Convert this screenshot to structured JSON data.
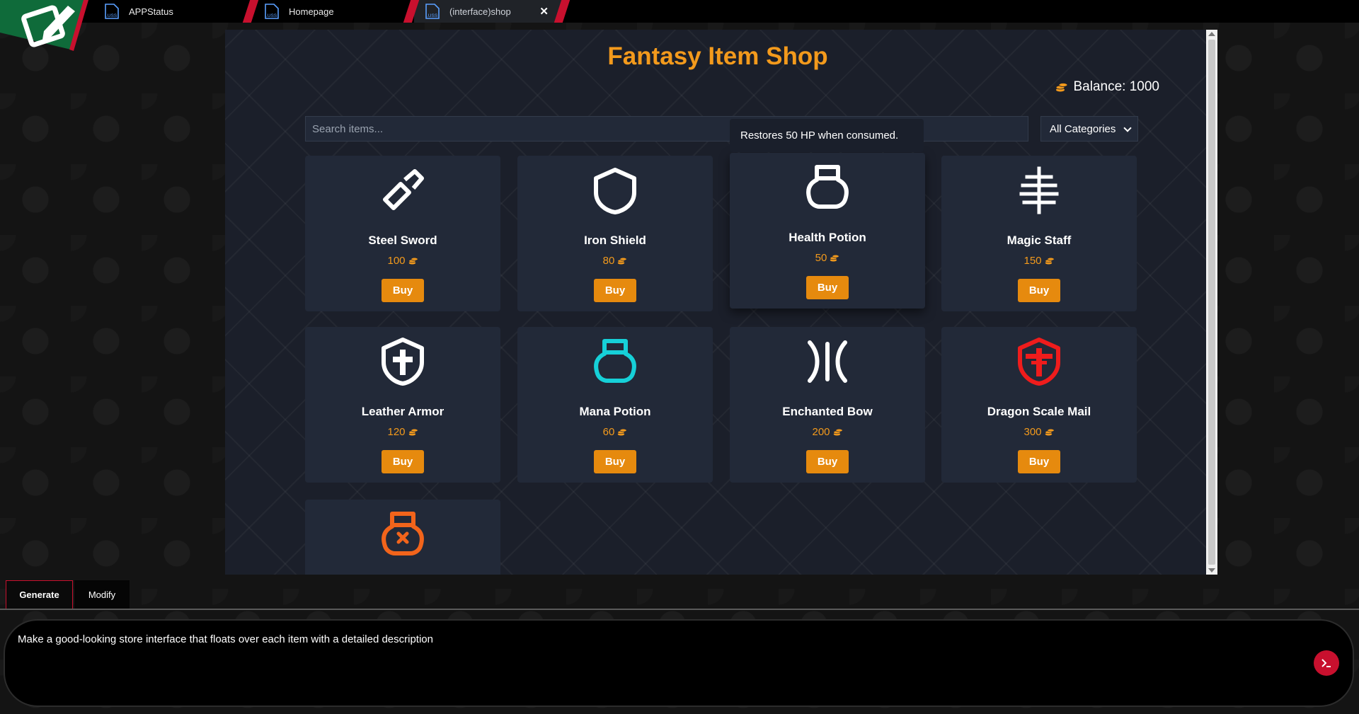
{
  "tabs": [
    {
      "label": "APPStatus",
      "icon": "uss-file-icon"
    },
    {
      "label": "Homepage",
      "icon": "uss-file-icon"
    },
    {
      "label": "(interface)shop",
      "icon": "uss-file-icon",
      "active": true
    }
  ],
  "file_icon_text": ".USS",
  "close_glyph": "✕",
  "shop": {
    "title": "Fantasy Item Shop",
    "balance": "Balance: 1000",
    "search_placeholder": "Search items...",
    "category": "All Categories",
    "tooltip": "Restores 50 HP when consumed.",
    "buy_label": "Buy",
    "items": [
      {
        "name": "Steel Sword",
        "price": "100",
        "icon": "sword-icon",
        "color": "#ffffff"
      },
      {
        "name": "Iron Shield",
        "price": "80",
        "icon": "shield-icon",
        "color": "#ffffff"
      },
      {
        "name": "Health Potion",
        "price": "50",
        "icon": "potion-icon",
        "color": "#ffffff"
      },
      {
        "name": "Magic Staff",
        "price": "150",
        "icon": "staff-icon",
        "color": "#ffffff"
      },
      {
        "name": "Leather Armor",
        "price": "120",
        "icon": "armor-icon",
        "color": "#ffffff"
      },
      {
        "name": "Mana Potion",
        "price": "60",
        "icon": "potion-icon",
        "color": "#16d0d8"
      },
      {
        "name": "Enchanted Bow",
        "price": "200",
        "icon": "bow-icon",
        "color": "#ffffff"
      },
      {
        "name": "Dragon Scale Mail",
        "price": "300",
        "icon": "armor-icon",
        "color": "#ef1c1c"
      },
      {
        "name": "",
        "price": "",
        "icon": "poison-potion-icon",
        "color": "#f2641b"
      }
    ]
  },
  "mode_tabs": {
    "generate": "Generate",
    "modify": "Modify"
  },
  "prompt": "Make a good-looking store interface that floats over each item with a detailed description",
  "colors": {
    "accent": "#f39a1c",
    "button": "#e68a0e",
    "brand_red": "#c8102e",
    "card_bg": "#222938"
  }
}
